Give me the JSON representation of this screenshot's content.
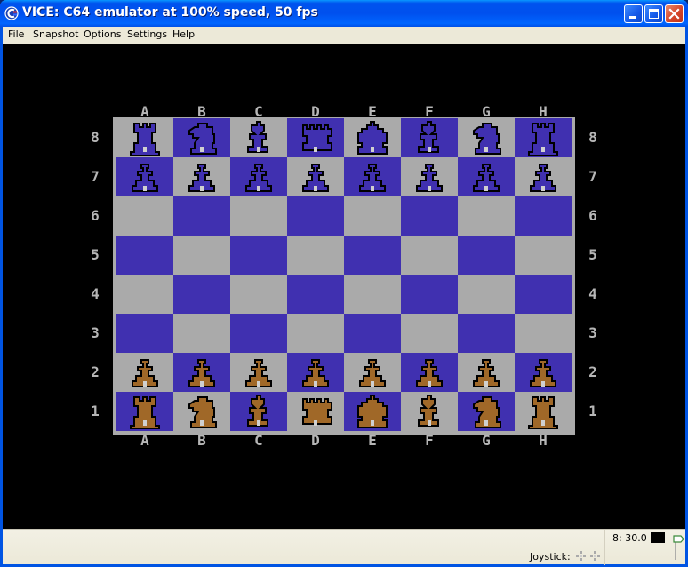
{
  "window": {
    "title": "VICE: C64 emulator at 100% speed, 50 fps",
    "icon": "vice-commodore-logo-icon",
    "controls": {
      "minimize": "minimize-icon",
      "maximize": "maximize-icon",
      "close": "close-icon"
    }
  },
  "menubar": {
    "items": [
      {
        "label": "File",
        "accel": "F"
      },
      {
        "label": "Snapshot",
        "accel": "p"
      },
      {
        "label": "Options",
        "accel": "O"
      },
      {
        "label": "Settings",
        "accel": "t"
      },
      {
        "label": "Help",
        "accel": "H"
      }
    ]
  },
  "board": {
    "colors": {
      "light_square": "#aaaaaa",
      "dark_square": "#4030b0",
      "black_piece": "#4030b0",
      "white_piece": "#a06828",
      "outline": "#000000",
      "coord_text": "#b6b6b6"
    },
    "files": [
      "A",
      "B",
      "C",
      "D",
      "E",
      "F",
      "G",
      "H"
    ],
    "ranks": [
      "8",
      "7",
      "6",
      "5",
      "4",
      "3",
      "2",
      "1"
    ],
    "position": [
      [
        "bR",
        "bN",
        "bB",
        "bQ",
        "bK",
        "bB",
        "bN",
        "bR"
      ],
      [
        "bP",
        "bP",
        "bP",
        "bP",
        "bP",
        "bP",
        "bP",
        "bP"
      ],
      [
        "",
        "",
        "",
        "",
        "",
        "",
        "",
        ""
      ],
      [
        "",
        "",
        "",
        "",
        "",
        "",
        "",
        ""
      ],
      [
        "",
        "",
        "",
        "",
        "",
        "",
        "",
        ""
      ],
      [
        "",
        "",
        "",
        "",
        "",
        "",
        "",
        ""
      ],
      [
        "wP",
        "wP",
        "wP",
        "wP",
        "wP",
        "wP",
        "wP",
        "wP"
      ],
      [
        "wR",
        "wN",
        "wB",
        "wQ",
        "wK",
        "wB",
        "wN",
        "wR"
      ]
    ]
  },
  "statusbar": {
    "joystick_label": "Joystick:",
    "drive_status": "8: 30.0",
    "drive_led_color": "#000000",
    "tape_icon": "tape-counter-icon"
  }
}
